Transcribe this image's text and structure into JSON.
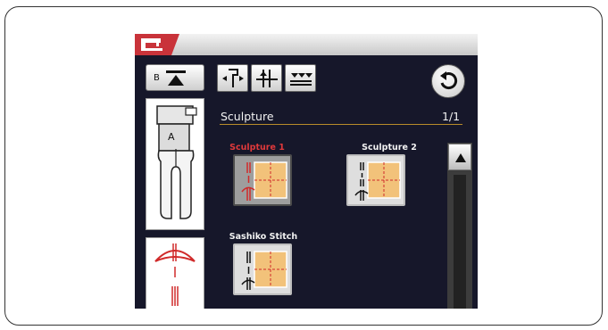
{
  "sidebar": {
    "foot_button_label": "B",
    "foot_label": "A"
  },
  "section": {
    "title": "Sculpture",
    "page": "1/1"
  },
  "patterns": [
    {
      "label": "Sculpture 1",
      "selected": true
    },
    {
      "label": "Sculpture 2",
      "selected": false
    },
    {
      "label": "Sashiko Stitch",
      "selected": false
    }
  ],
  "colors": {
    "accent_red": "#c9333a",
    "screen_bg": "#16172a",
    "selected_label": "#e0393b",
    "label": "#f2f2f2",
    "pattern_fill": "#f2c27a"
  },
  "icons": [
    "sewing-machine-icon",
    "presser-foot-lift-icon",
    "needle-position-icon",
    "needle-up-down-icon",
    "feed-dog-icon",
    "back-arrow-icon",
    "scroll-up-icon"
  ]
}
